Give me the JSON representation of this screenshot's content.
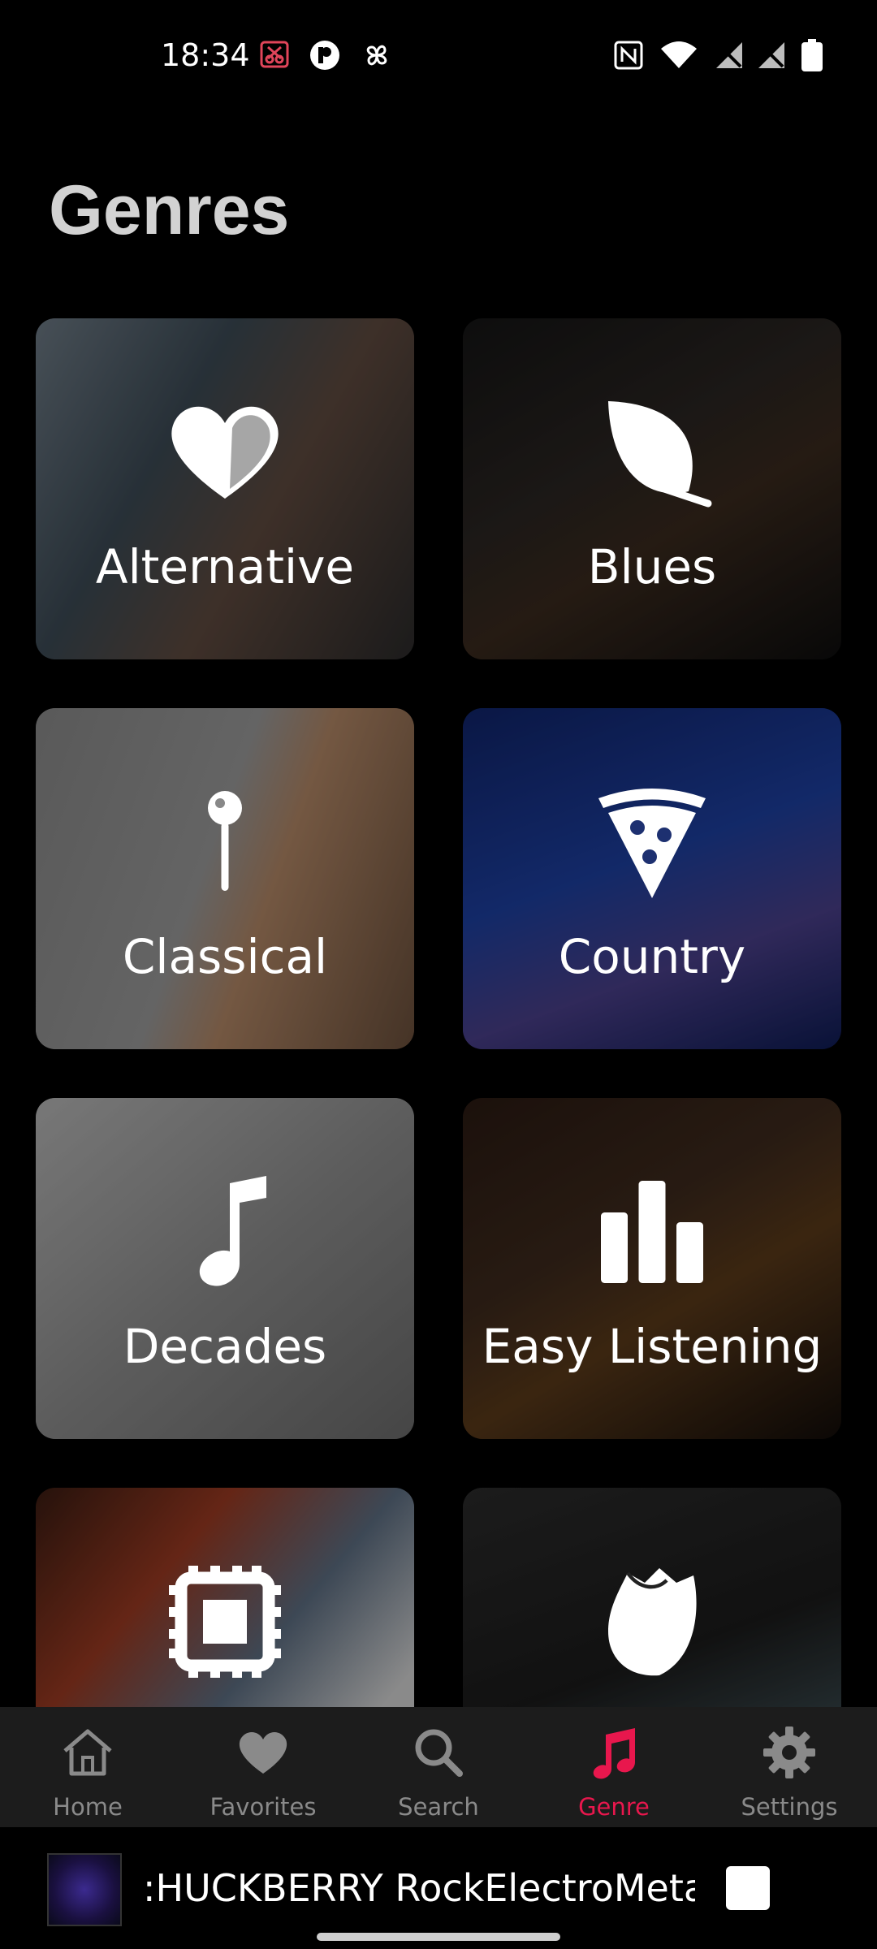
{
  "status_bar": {
    "time": "18:34",
    "left_icons": [
      "screenshot-icon",
      "app-icon",
      "pinwheel-icon"
    ],
    "right_icons": [
      "nfc-icon",
      "wifi-icon",
      "signal-off-icon",
      "signal-off-icon",
      "battery-icon"
    ]
  },
  "page": {
    "title": "Genres"
  },
  "genres": [
    {
      "label": "Alternative",
      "icon": "half-heart-icon"
    },
    {
      "label": "Blues",
      "icon": "leaf-icon"
    },
    {
      "label": "Classical",
      "icon": "pin-icon"
    },
    {
      "label": "Country",
      "icon": "pizza-slice-icon"
    },
    {
      "label": "Decades",
      "icon": "music-note-icon"
    },
    {
      "label": "Easy Listening",
      "icon": "bar-chart-icon"
    },
    {
      "label": "",
      "icon": "chip-icon"
    },
    {
      "label": "",
      "icon": "rose-icon"
    }
  ],
  "nav": {
    "items": [
      {
        "label": "Home",
        "icon": "home-icon"
      },
      {
        "label": "Favorites",
        "icon": "heart-icon"
      },
      {
        "label": "Search",
        "icon": "search-icon"
      },
      {
        "label": "Genre",
        "icon": "music-note-icon",
        "active": true
      },
      {
        "label": "Settings",
        "icon": "gear-icon"
      }
    ],
    "active_color": "#e8174d",
    "inactive_color": "#8a8a8a"
  },
  "player": {
    "title": ":HUCKBERRY RockElectroMetal"
  }
}
